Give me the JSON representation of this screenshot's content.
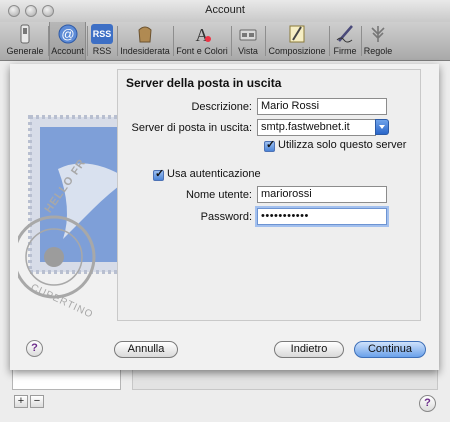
{
  "window": {
    "title": "Account"
  },
  "toolbar": {
    "items": [
      {
        "label": "Generale",
        "icon": "switch-icon"
      },
      {
        "label": "Account",
        "icon": "at-sign-icon"
      },
      {
        "label": "RSS",
        "icon": "rss-icon"
      },
      {
        "label": "Indesiderata",
        "icon": "junk-bag-icon"
      },
      {
        "label": "Font e Colori",
        "icon": "font-icon"
      },
      {
        "label": "Vista",
        "icon": "glasses-icon"
      },
      {
        "label": "Composizione",
        "icon": "compose-icon"
      },
      {
        "label": "Firme",
        "icon": "signature-pen-icon"
      },
      {
        "label": "Regole",
        "icon": "rules-icon"
      }
    ],
    "rss_badge": "RSS"
  },
  "dialog": {
    "heading": "Server della posta in uscita",
    "description_label": "Descrizione:",
    "description_value": "Mario Rossi",
    "server_label": "Server di posta in uscita:",
    "server_value": "smtp.fastwebnet.it",
    "only_this_server_label": "Utilizza solo questo server",
    "only_this_server_checked": true,
    "use_auth_label": "Usa autenticazione",
    "use_auth_checked": true,
    "username_label": "Nome utente:",
    "username_value": "mariorossi",
    "password_label": "Password:",
    "password_value": "•••••••••••",
    "cancel_label": "Annulla",
    "back_label": "Indietro",
    "continue_label": "Continua",
    "help_label": "?"
  },
  "stamp": {
    "text_top": "HELLO FR",
    "text_bottom": "CUPERTINO"
  },
  "bottom": {
    "add_label": "+",
    "remove_label": "−",
    "help_label": "?"
  },
  "colors": {
    "accent": "#3b78d8",
    "stamp_blue": "#7e9fd8"
  }
}
